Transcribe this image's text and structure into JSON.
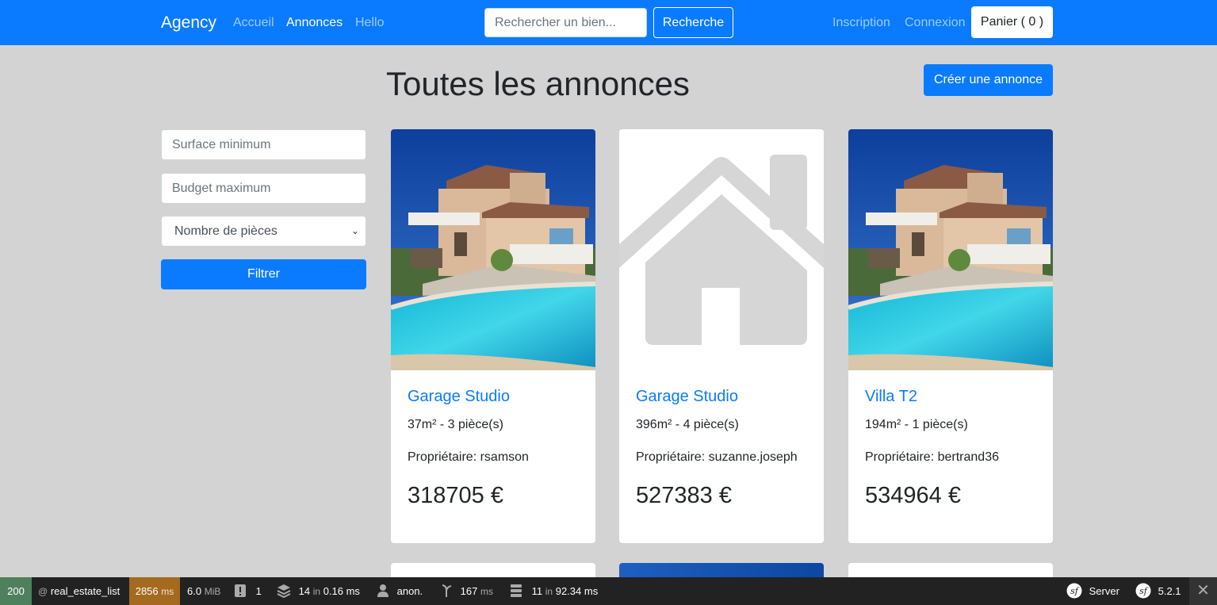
{
  "nav": {
    "brand": "Agency",
    "links": [
      {
        "label": "Accueil",
        "active": false
      },
      {
        "label": "Annonces",
        "active": true
      },
      {
        "label": "Hello",
        "active": false
      }
    ],
    "search_placeholder": "Rechercher un bien...",
    "search_button": "Recherche",
    "register": "Inscription",
    "login": "Connexion",
    "cart": "Panier ( 0 )"
  },
  "header": {
    "title": "Toutes les annonces",
    "create_button": "Créer une annonce"
  },
  "filters": {
    "surface_placeholder": "Surface minimum",
    "budget_placeholder": "Budget maximum",
    "rooms_selected": "Nombre de pièces",
    "submit": "Filtrer"
  },
  "listings": [
    {
      "title": "Garage Studio",
      "specs": "37m² - 3 pièce(s)",
      "owner": "Propriétaire: rsamson",
      "price": "318705 €",
      "image": "villa-pool-photo"
    },
    {
      "title": "Garage Studio",
      "specs": "396m² - 4 pièce(s)",
      "owner": "Propriétaire: suzanne.joseph",
      "price": "527383 €",
      "image": "house-placeholder-icon"
    },
    {
      "title": "Villa T2",
      "specs": "194m² - 1 pièce(s)",
      "owner": "Propriétaire: bertrand36",
      "price": "534964 €",
      "image": "villa-pool-photo"
    }
  ],
  "toolbar": {
    "status": "200",
    "route": "real_estate_list",
    "time": "2856",
    "time_unit": "ms",
    "memory": "6.0",
    "memory_unit": "MiB",
    "logs": "1",
    "cache": "14",
    "cache_in": "in",
    "cache_time": "0.16 ms",
    "user": "anon.",
    "twig": "167",
    "twig_unit": "ms",
    "db": "11",
    "db_in": "in",
    "db_time": "92.34 ms",
    "server": "Server",
    "version": "5.2.1"
  },
  "colors": {
    "primary": "#0a7bff",
    "background": "#d3d3d3",
    "toolbar": "#222222",
    "status_ok": "#4f805d",
    "time_warn": "#a46a1f"
  }
}
